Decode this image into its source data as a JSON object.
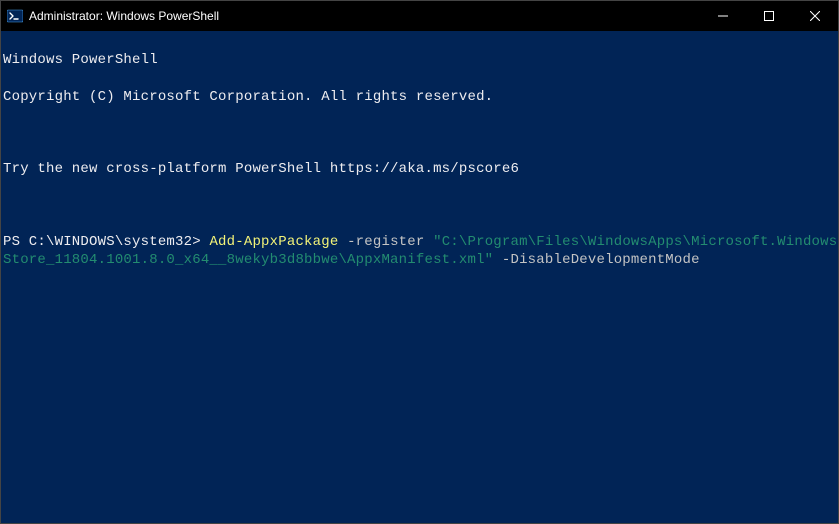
{
  "window": {
    "title": "Administrator: Windows PowerShell"
  },
  "terminal": {
    "banner_line1": "Windows PowerShell",
    "banner_line2": "Copyright (C) Microsoft Corporation. All rights reserved.",
    "tip_line": "Try the new cross-platform PowerShell https://aka.ms/pscore6",
    "prompt": "PS C:\\WINDOWS\\system32> ",
    "cmdlet": "Add-AppxPackage",
    "param_register": " -register ",
    "string_arg": "\"C:\\Program\\Files\\WindowsApps\\Microsoft.WindowsStore_11804.1001.8.0_x64__8wekyb3d8bbwe\\AppxManifest.xml\"",
    "param_disable": " -DisableDevelopmentMode"
  }
}
